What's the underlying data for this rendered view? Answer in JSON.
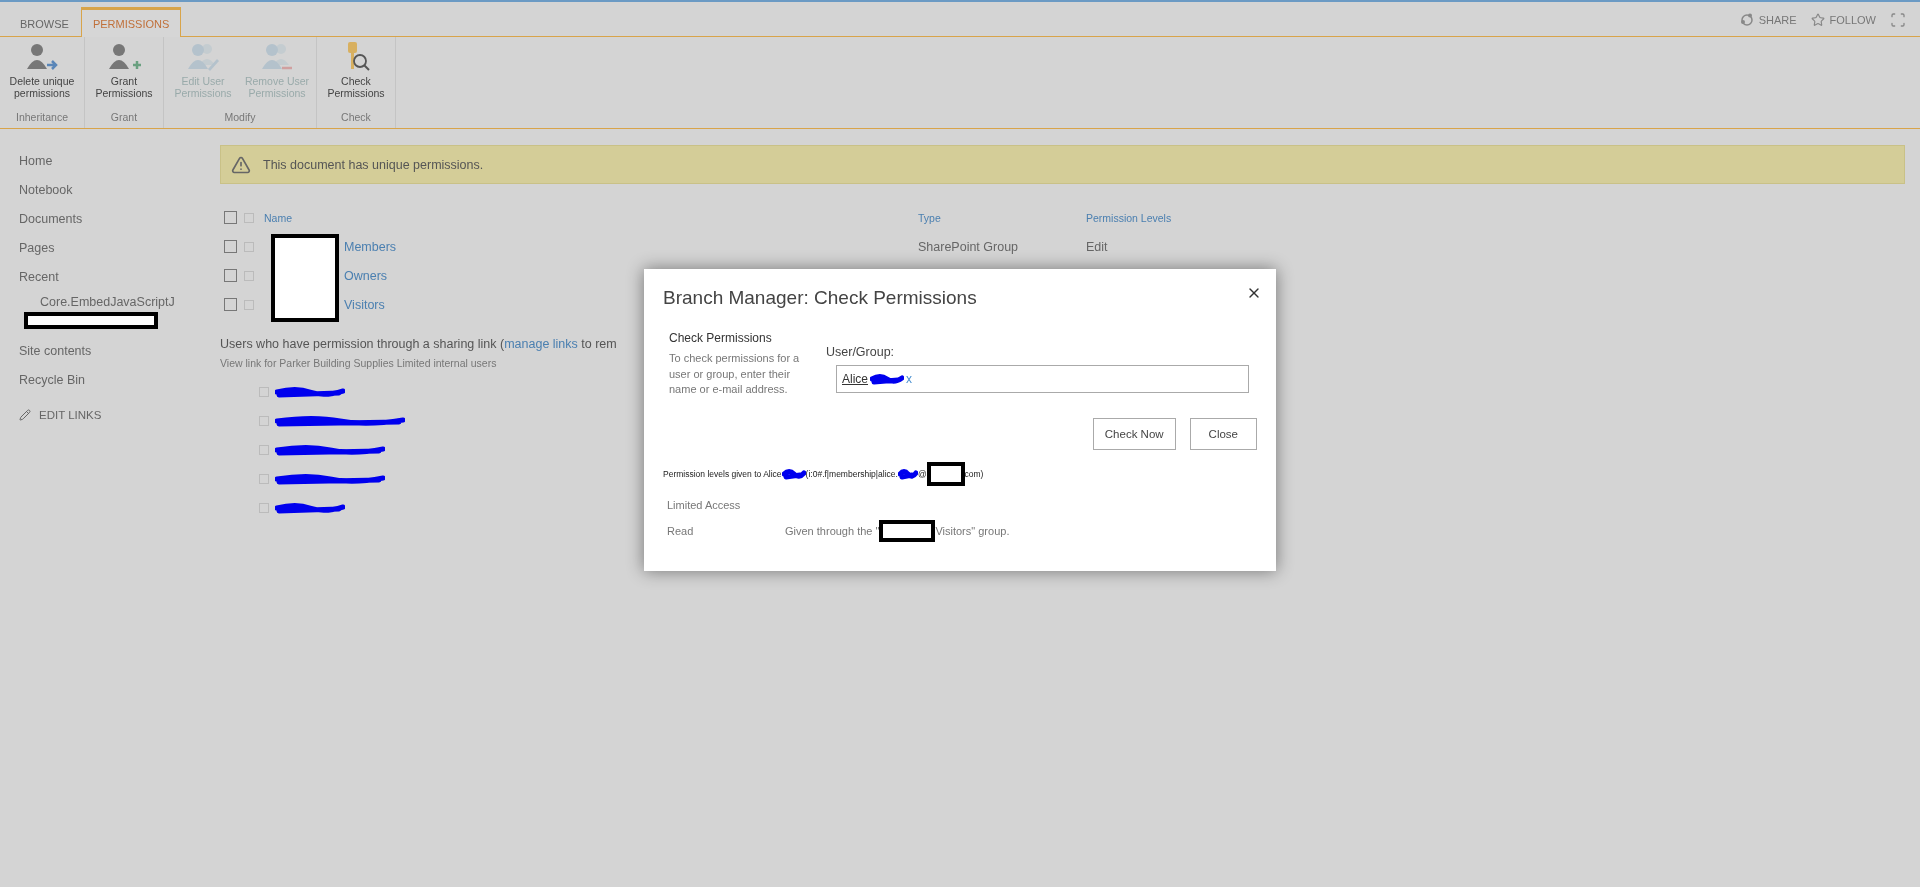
{
  "tabs": [
    {
      "label": "BROWSE",
      "selected": false
    },
    {
      "label": "PERMISSIONS",
      "selected": true
    }
  ],
  "top_actions": [
    {
      "kind": "share",
      "label": "SHARE"
    },
    {
      "kind": "follow",
      "label": "FOLLOW"
    },
    {
      "kind": "focus"
    }
  ],
  "ribbon_groups": [
    {
      "label": "Inheritance",
      "buttons": [
        {
          "kind": "delete",
          "label": "Delete unique permissions",
          "disabled": false
        }
      ]
    },
    {
      "label": "Grant",
      "buttons": [
        {
          "kind": "grant",
          "label": "Grant Permissions",
          "disabled": false
        }
      ]
    },
    {
      "label": "Modify",
      "buttons": [
        {
          "kind": "edit",
          "label": "Edit User Permissions",
          "disabled": true
        },
        {
          "kind": "remove",
          "label": "Remove User Permissions",
          "disabled": true
        }
      ]
    },
    {
      "label": "Check",
      "buttons": [
        {
          "kind": "check",
          "label": "Check Permissions",
          "disabled": false
        }
      ]
    }
  ],
  "sidebar": {
    "items": [
      {
        "label": "Home"
      },
      {
        "label": "Notebook"
      },
      {
        "label": "Documents"
      },
      {
        "label": "Pages"
      },
      {
        "label": "Recent",
        "children": [
          {
            "label": "Core.EmbedJavaScriptJ"
          },
          {
            "kind": "redacted"
          }
        ]
      },
      {
        "label": "Site contents"
      },
      {
        "label": "Recycle Bin"
      }
    ],
    "edit_links": "EDIT LINKS"
  },
  "notice": "This document has unique permissions.",
  "table": {
    "columns": [
      "Name",
      "Type",
      "Permission Levels"
    ],
    "header": {
      "checked": false,
      "item_checked": false
    },
    "rows": [
      {
        "name": "Members",
        "type": "SharePoint Group",
        "permission_levels": "Edit",
        "checked": false,
        "item_checked": false
      },
      {
        "name": "Owners",
        "checked": false,
        "item_checked": false
      },
      {
        "name": "Visitors",
        "checked": false,
        "item_checked": false
      }
    ]
  },
  "sharing": {
    "text_before": "Users who have permission through a sharing link (",
    "link": "manage links",
    "text_after": "to rem",
    "subtext": "View link for Parker Building Supplies Limited internal users",
    "users": [
      {
        "checked": false
      },
      {
        "checked": false
      },
      {
        "checked": false
      },
      {
        "checked": false
      },
      {
        "checked": false
      }
    ]
  },
  "dialog": {
    "title": "Branch Manager: Check Permissions",
    "section_title": "Check Permissions",
    "description": "To check permissions for a user or group, enter their name or e-mail address.",
    "field_label": "User/Group:",
    "value_name": "Alice",
    "value_remove": "x",
    "buttons": [
      "Check Now",
      "Close"
    ],
    "result_parts": [
      "Permission levels given to Alice",
      "(i:0#.f|membership|alice.",
      "@",
      "com)"
    ],
    "levels": [
      {
        "level": "Limited Access"
      },
      {
        "level": "Read",
        "detail_before": "Given through the \"",
        "detail_after": "Visitors\" group."
      }
    ]
  }
}
